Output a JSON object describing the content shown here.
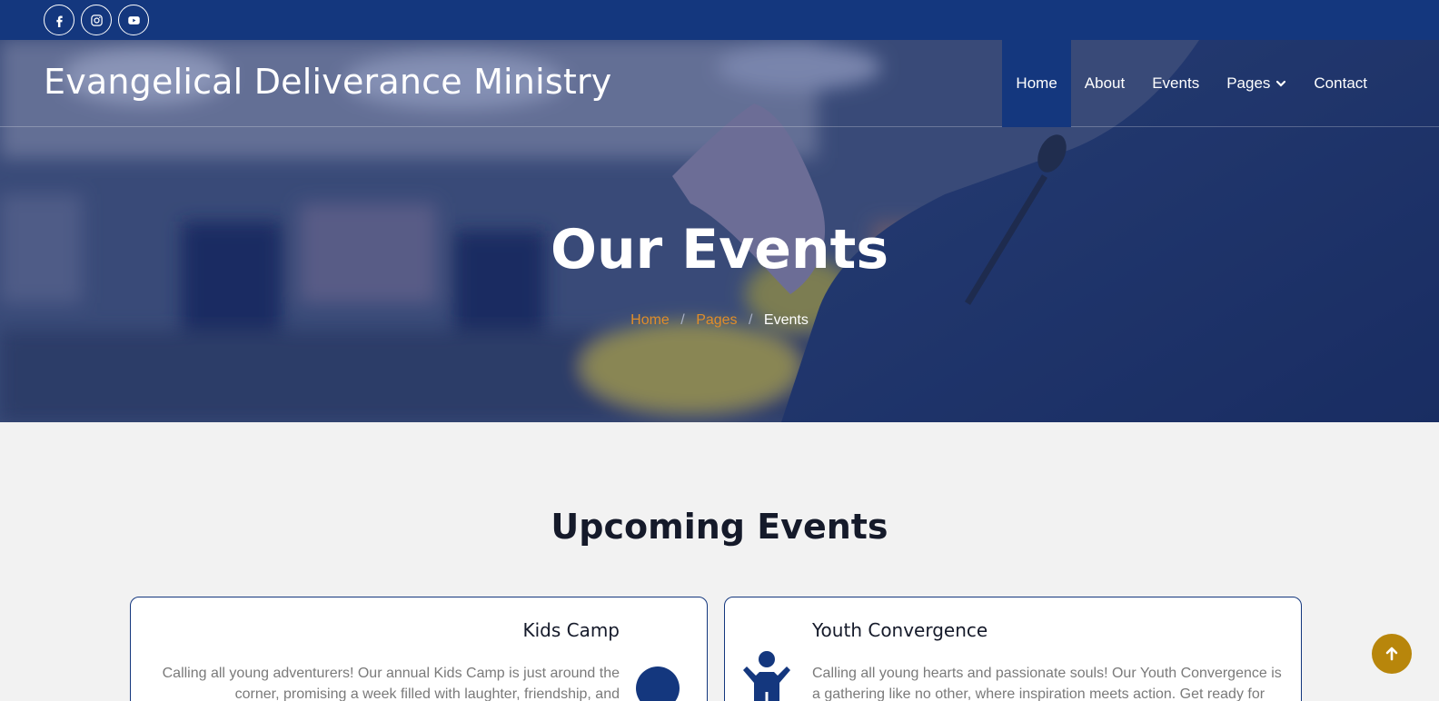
{
  "topbar": {
    "social": [
      {
        "icon": "facebook-icon"
      },
      {
        "icon": "instagram-icon"
      },
      {
        "icon": "youtube-icon"
      }
    ]
  },
  "header": {
    "brand": "Evangelical Deliverance Ministry",
    "nav": [
      {
        "label": "Home",
        "active": true
      },
      {
        "label": "About"
      },
      {
        "label": "Events"
      },
      {
        "label": "Pages",
        "has_dropdown": true
      },
      {
        "label": "Contact"
      }
    ]
  },
  "hero": {
    "title": "Our Events",
    "breadcrumb": [
      "Home",
      "Pages",
      "Events"
    ],
    "separator": "/"
  },
  "section": {
    "title": "Upcoming Events"
  },
  "events": [
    {
      "title": "Kids Camp",
      "text": "Calling all young adventurers! Our annual Kids Camp is just around the corner, promising a week filled with laughter, friendship, and",
      "icon": "circle-icon"
    },
    {
      "title": "Youth Convergence",
      "text": "Calling all young hearts and passionate souls! Our Youth Convergence is a gathering like no other, where inspiration meets action. Get ready for",
      "icon": "child-icon"
    }
  ],
  "back_to_top": {
    "icon": "arrow-up-icon"
  },
  "colors": {
    "primary": "#14377e",
    "accent": "#e08d2a",
    "back_to_top": "#b8860b"
  }
}
